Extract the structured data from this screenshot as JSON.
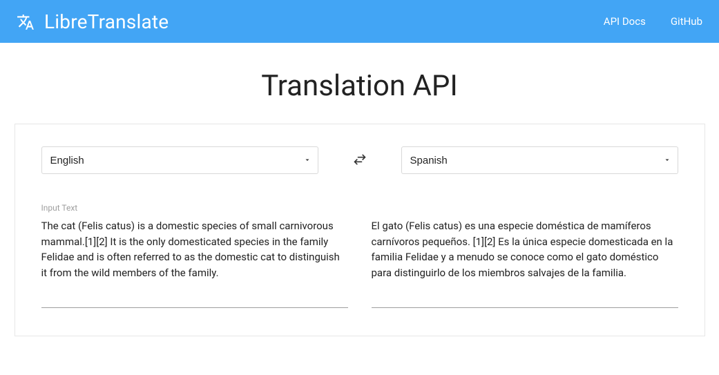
{
  "nav": {
    "brand": "LibreTranslate",
    "links": {
      "api_docs": "API Docs",
      "github": "GitHub"
    }
  },
  "page_title": "Translation API",
  "source_lang": "English",
  "target_lang": "Spanish",
  "input_label": "Input Text",
  "input_text": "The cat (Felis catus) is a domestic species of small carnivorous mammal.[1][2] It is the only domesticated species in the family Felidae and is often referred to as the domestic cat to distinguish it from the wild members of the family.",
  "output_text": "El gato (Felis catus) es una especie doméstica de mamíferos carnívoros pequeños. [1][2] Es la única especie domesticada en la familia Felidae y a menudo se conoce como el gato doméstico para distinguirlo de los miembros salvajes de la familia."
}
